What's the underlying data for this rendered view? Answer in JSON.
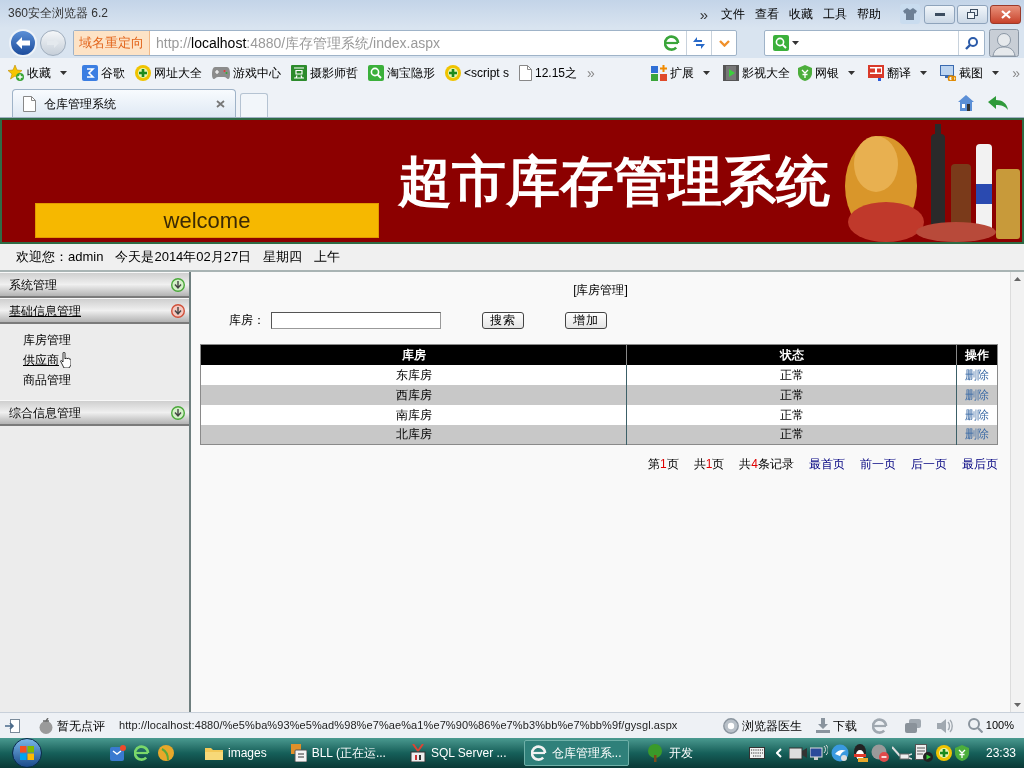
{
  "window": {
    "title": "360安全浏览器 6.2",
    "menu_overflow": "»",
    "menu": [
      "文件",
      "查看",
      "收藏",
      "工具",
      "帮助"
    ]
  },
  "address_bar": {
    "badge": "域名重定向",
    "url": {
      "scheme": "http://",
      "host": "localhost",
      "path": ":4880/库存管理系统/index.aspx"
    }
  },
  "bookmarks": {
    "left": [
      {
        "label": "收藏",
        "dropdown": true
      },
      {
        "label": "谷歌",
        "dropdown": false
      },
      {
        "label": "网址大全",
        "dropdown": false
      },
      {
        "label": "游戏中心",
        "dropdown": false
      },
      {
        "label": "摄影师哲",
        "dropdown": false
      },
      {
        "label": "淘宝隐形",
        "dropdown": false
      },
      {
        "label": "<script s",
        "dropdown": false
      },
      {
        "label": "12.15之",
        "dropdown": false
      }
    ],
    "left_overflow": "»",
    "right": [
      {
        "label": "扩展",
        "dropdown": true
      },
      {
        "label": "影视大全",
        "dropdown": false
      },
      {
        "label": "网银",
        "dropdown": true
      },
      {
        "label": "翻译",
        "dropdown": true
      },
      {
        "label": "截图",
        "dropdown": true
      }
    ],
    "right_overflow": "»"
  },
  "tabs": [
    {
      "label": "仓库管理系统",
      "selected": true
    }
  ],
  "banner": {
    "welcome": "welcome",
    "title": "超市库存管理系统"
  },
  "user_bar": [
    "欢迎您：admin",
    "今天是2014年02月27日",
    "星期四",
    "上午"
  ],
  "sidebar": {
    "sections": [
      {
        "title": "系统管理",
        "expanded": false
      },
      {
        "title": "基础信息管理",
        "expanded": true,
        "children": [
          {
            "label": "库房管理",
            "hovered": false
          },
          {
            "label": "供应商",
            "hovered": true
          },
          {
            "label": "商品管理",
            "hovered": false
          }
        ]
      },
      {
        "title": "综合信息管理",
        "expanded": false
      }
    ]
  },
  "content": {
    "heading": "[库房管理]",
    "search": {
      "label": "库房："
    },
    "buttons": [
      "搜索",
      "增加"
    ],
    "table": {
      "columns": [
        "库房",
        "状态",
        "操作"
      ],
      "rows": [
        {
          "cells": [
            "东库房",
            "正常"
          ],
          "action": "删除"
        },
        {
          "cells": [
            "西库房",
            "正常"
          ],
          "action": "删除"
        },
        {
          "cells": [
            "南库房",
            "正常"
          ],
          "action": "删除"
        },
        {
          "cells": [
            "北库房",
            "正常"
          ],
          "action": "删除"
        }
      ]
    },
    "pagination": [
      {
        "kind": "count",
        "parts": [
          "第",
          "1",
          "页"
        ]
      },
      {
        "kind": "count",
        "parts": [
          "共",
          "1",
          "页"
        ]
      },
      {
        "kind": "count",
        "parts": [
          "共",
          "4",
          "条记录"
        ]
      },
      {
        "kind": "link",
        "text": "最首页"
      },
      {
        "kind": "link",
        "text": "前一页"
      },
      {
        "kind": "link",
        "text": "后一页"
      },
      {
        "kind": "link",
        "text": "最后页"
      }
    ]
  },
  "status_bar": {
    "rating": "暂无点评",
    "url": "http://localhost:4880/%e5%ba%93%e5%ad%98%e7%ae%a1%e7%90%86%e7%b3%bb%e7%bb%9f/gysgl.aspx",
    "doctor": "浏览器医生",
    "download": "下载",
    "zoom": "100%"
  },
  "taskbar": {
    "tasks": [
      {
        "label": "images",
        "selected": false
      },
      {
        "label": "BLL (正在运...",
        "selected": false
      },
      {
        "label": "SQL Server ...",
        "selected": false
      },
      {
        "label": "仓库管理系...",
        "selected": true
      },
      {
        "label": "开发",
        "selected": false
      }
    ],
    "clock": "23:33"
  }
}
